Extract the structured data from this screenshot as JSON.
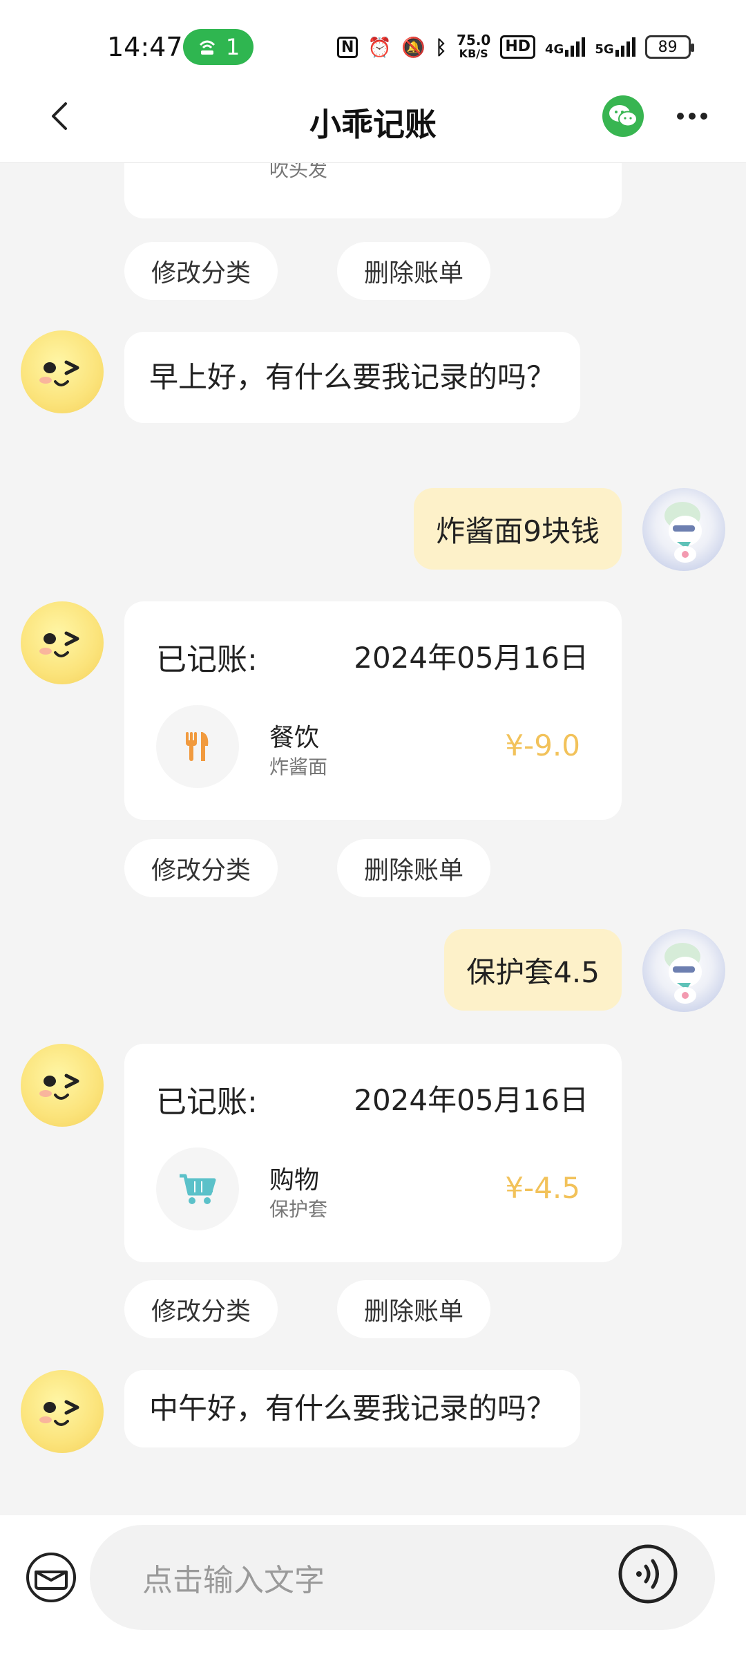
{
  "status_bar": {
    "time": "14:47",
    "hotspot_count": "1",
    "net_speed_value": "75.0",
    "net_speed_unit": "KB/S",
    "hd_label": "HD",
    "signal_4g": "4G",
    "signal_5g": "5G",
    "battery": "89"
  },
  "header": {
    "title": "小乖记账",
    "back_icon": "chevron-left-icon",
    "wechat_icon": "wechat-icon",
    "more_icon": "more-dots-icon"
  },
  "messages": {
    "partial_card_note": "吹头发",
    "actions_1": {
      "edit": "修改分类",
      "delete": "删除账单"
    },
    "bot_greeting_morning": "早上好，有什么要我记录的吗？",
    "user_msg_1": "炸酱面9块钱",
    "record_1": {
      "label": "已记账:",
      "date": "2024年05月16日",
      "category": "餐饮",
      "note": "炸酱面",
      "amount": "¥-9.0",
      "icon": "utensils-icon"
    },
    "actions_2": {
      "edit": "修改分类",
      "delete": "删除账单"
    },
    "user_msg_2": "保护套4.5",
    "record_2": {
      "label": "已记账:",
      "date": "2024年05月16日",
      "category": "购物",
      "note": "保护套",
      "amount": "¥-4.5",
      "icon": "shopping-cart-icon"
    },
    "actions_3": {
      "edit": "修改分类",
      "delete": "删除账单"
    },
    "bot_greeting_noon": "中午好，有什么要我记录的吗？"
  },
  "input_bar": {
    "placeholder": "点击输入文字",
    "left_icon": "wallet-icon",
    "right_icon": "voice-icon"
  },
  "colors": {
    "amount": "#f2c25a",
    "user_bubble": "#fdf1c9",
    "wechat_green": "#38b551",
    "food_icon": "#f19a3e",
    "cart_icon": "#5bc1c9"
  }
}
